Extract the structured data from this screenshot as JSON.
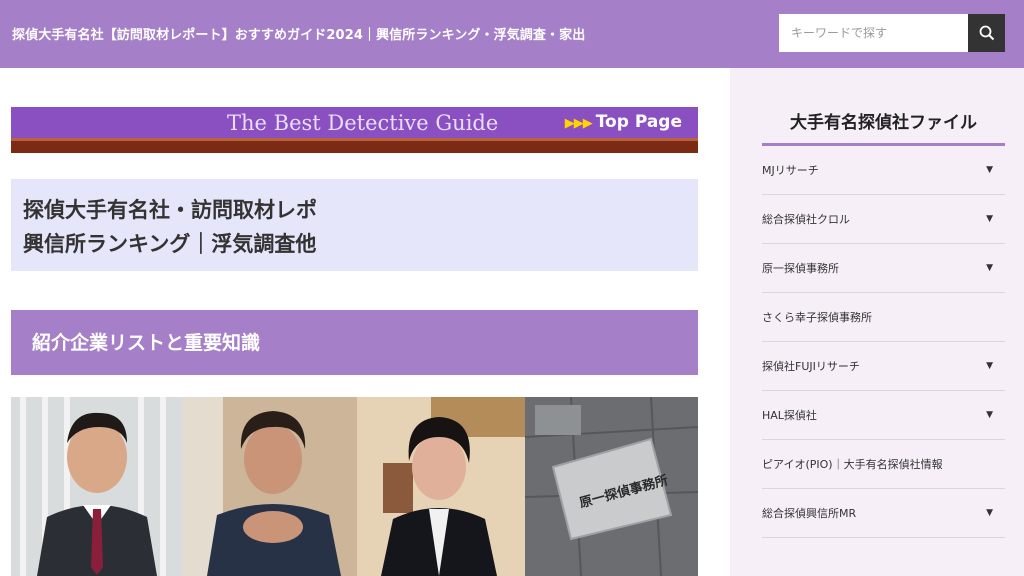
{
  "header": {
    "site_title": "探偵大手有名社【訪問取材レポート】おすすめガイド2024｜興信所ランキング・浮気調査・家出",
    "search_placeholder": "キーワードで探す",
    "search_icon": "search-icon"
  },
  "banner": {
    "text": "The Best Detective Guide",
    "arrows": "▶▶▶",
    "link_label": "Top Page"
  },
  "headline": {
    "line1": "探偵大手有名社・訪問取材レポ",
    "line2": "興信所ランキング｜浮気調査他"
  },
  "section": {
    "title": "紹介企業リストと重要知識"
  },
  "sidebar": {
    "title": "大手有名探偵社ファイル",
    "items": [
      {
        "label": "MJリサーチ",
        "caret": "▼"
      },
      {
        "label": "総合探偵社クロル",
        "caret": "▼"
      },
      {
        "label": "原一探偵事務所",
        "caret": "▼"
      },
      {
        "label": "さくら幸子探偵事務所",
        "caret": ""
      },
      {
        "label": "探偵社FUJIリサーチ",
        "caret": "▼"
      },
      {
        "label": "HAL探偵社",
        "caret": "▼"
      },
      {
        "label": "ピアイオ(PIO)｜大手有名探偵社情報",
        "caret": ""
      },
      {
        "label": "総合探偵興信所MR",
        "caret": "▼"
      }
    ]
  },
  "photo": {
    "sign_line1": "原一探偵事務所"
  },
  "colors": {
    "header_bg": "#a57fc8",
    "headline_bg": "#e6e6fa",
    "sidebar_bg": "#f6eff8",
    "banner_bg": "#8a4fc0",
    "accent": "#a57fc8"
  }
}
